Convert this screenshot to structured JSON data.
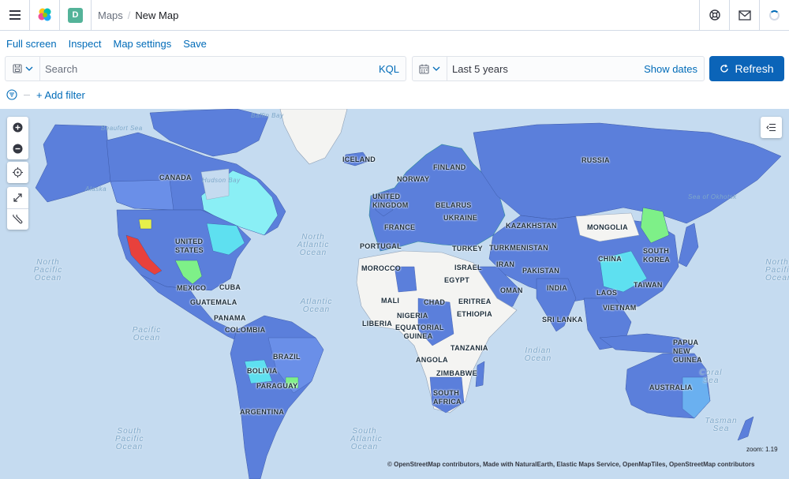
{
  "header": {
    "space_initial": "D",
    "breadcrumb_parent": "Maps",
    "breadcrumb_current": "New Map"
  },
  "topnav": {
    "full_screen": "Full screen",
    "inspect": "Inspect",
    "map_settings": "Map settings",
    "save": "Save"
  },
  "query": {
    "placeholder": "Search",
    "language": "KQL"
  },
  "time": {
    "range": "Last 5 years",
    "show_dates": "Show dates"
  },
  "refresh_label": "Refresh",
  "filter": {
    "add_label": "+ Add filter"
  },
  "map": {
    "zoom_text": "zoom: 1.19",
    "attribution": "© OpenStreetMap contributors, Made with NaturalEarth, Elastic Maps Service, OpenMapTiles, OpenStreetMap contributors",
    "country_labels": [
      "CANADA",
      "UNITED STATES",
      "MEXICO",
      "CUBA",
      "GUATEMALA",
      "PANAMA",
      "COLOMBIA",
      "BRAZIL",
      "BOLIVIA",
      "PARAGUAY",
      "ARGENTINA",
      "ICELAND",
      "UNITED KINGDOM",
      "FINLAND",
      "NORWAY",
      "BELARUS",
      "UKRAINE",
      "FRANCE",
      "PORTUGAL",
      "TURKEY",
      "RUSSIA",
      "KAZAKHSTAN",
      "MONGOLIA",
      "TURKMENISTAN",
      "SOUTH KOREA",
      "CHINA",
      "PAKISTAN",
      "IRAN",
      "ISRAEL",
      "EGYPT",
      "MOROCCO",
      "MALI",
      "CHAD",
      "ERITREA",
      "ETHIOPIA",
      "NIGERIA",
      "LIBERIA",
      "EQUATORIAL GUINEA",
      "TANZANIA",
      "ANGOLA",
      "ZIMBABWE",
      "SOUTH AFRICA",
      "OMAN",
      "INDIA",
      "LAOS",
      "VIETNAM",
      "TAIWAN",
      "SRI LANKA",
      "PAPUA NEW GUINEA",
      "AUSTRALIA"
    ],
    "ocean_labels": [
      "North Pacific Ocean",
      "North Atlantic Ocean",
      "Atlantic Ocean",
      "Pacific Ocean",
      "Indian Ocean",
      "South Pacific Ocean",
      "South Atlantic Ocean",
      "Coral Sea",
      "Tasman Sea",
      "North Pacific Ocean"
    ],
    "water_labels": [
      "Beaufort Sea",
      "Alaska",
      "Hudson Bay",
      "Baffin Bay",
      "Sea of Okhotsk"
    ]
  },
  "colors": {
    "accent": "#0b64b8",
    "link": "#006bb8",
    "ocean": "#c5dbf0",
    "fill_blue": "#5b7fdb",
    "fill_cyan": "#5ee0f0",
    "fill_red": "#e8413c",
    "fill_green": "#7ef088",
    "fill_yellow": "#e6f04a"
  }
}
